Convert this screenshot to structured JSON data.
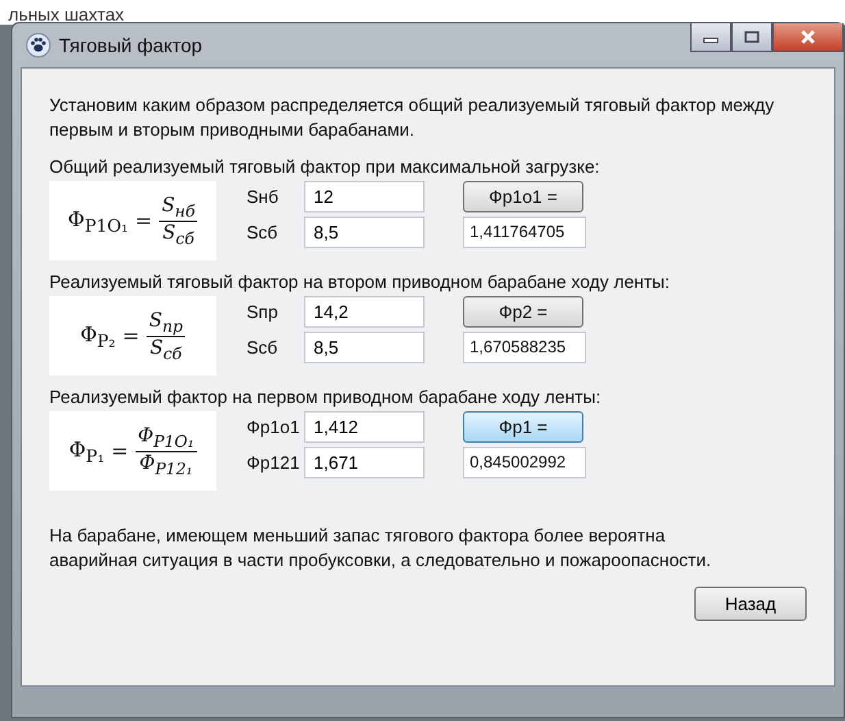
{
  "background_text": "льных шахтах",
  "window": {
    "title": "Тяговый фактор"
  },
  "intro": "Установим каким образом распределяется общий реализуемый тяговый фактор между первым и вторым приводными барабанами.",
  "sections": [
    {
      "heading": "Общий реализуемый тяговый фактор при максимальной загрузке:",
      "formula": {
        "lhs": "Φ$_{P1O₁}$",
        "relation": "=",
        "numerator": "S$_{нб}$",
        "denominator": "S$_{сб}$"
      },
      "fields": [
        {
          "label": "Sнб",
          "value": "12"
        },
        {
          "label": "Sсб",
          "value": "8,5"
        }
      ],
      "button": {
        "label": "Фр1о1 =",
        "focused": false
      },
      "result": "1,411764705"
    },
    {
      "heading": "Реализуемый тяговый фактор на втором приводном барабане ходу ленты:",
      "formula": {
        "lhs": "Φ$_{P₂}$",
        "relation": "=",
        "numerator": "S$_{пр}$",
        "denominator": "S$_{сб}$"
      },
      "fields": [
        {
          "label": "Sпр",
          "value": "14,2"
        },
        {
          "label": "Sсб",
          "value": "8,5"
        }
      ],
      "button": {
        "label": "Фр2 =",
        "focused": false
      },
      "result": "1,670588235"
    },
    {
      "heading": "Реализуемый фактор на первом приводном барабане ходу ленты:",
      "formula": {
        "lhs": "Φ$_{P₁}$",
        "relation": "=",
        "numerator": "Φ$_{P1O₁}$",
        "denominator": "Φ$_{P12₁}$"
      },
      "fields": [
        {
          "label": "Фр1о1",
          "value": "1,412"
        },
        {
          "label": "Фр121",
          "value": "1,671"
        }
      ],
      "button": {
        "label": "Фр1 =",
        "focused": true
      },
      "result": "0,845002992"
    }
  ],
  "conclusion": "На барабане, имеющем меньший запас тягового фактора более вероятна аварийная ситуация в части пробуксовки, а следовательно и пожароопасности.",
  "back_button": "Назад"
}
